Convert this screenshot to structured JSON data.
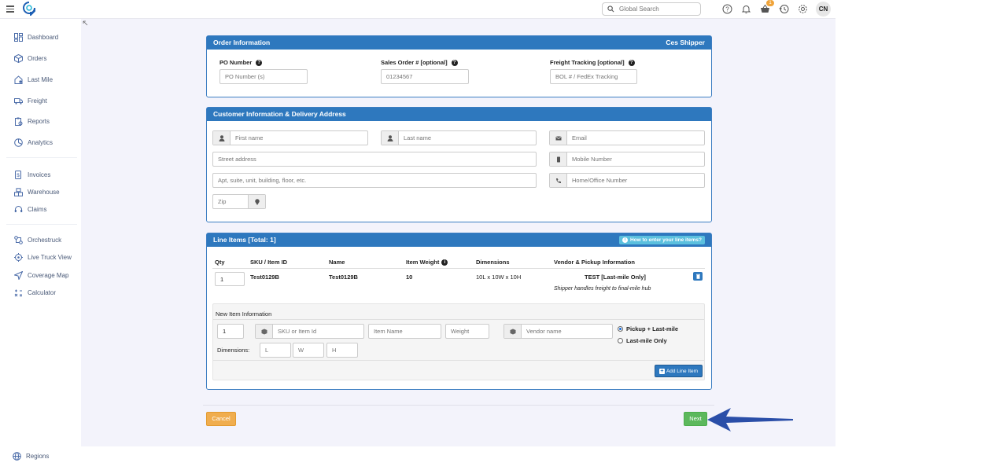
{
  "topbar": {
    "search_placeholder": "Global Search",
    "notification_count": "1",
    "avatar_initials": "CN"
  },
  "sidebar": {
    "items": [
      {
        "label": "Dashboard",
        "icon": "dashboard-icon"
      },
      {
        "label": "Orders",
        "icon": "box-icon"
      },
      {
        "label": "Last Mile",
        "icon": "house-icon"
      },
      {
        "label": "Freight",
        "icon": "truck-icon"
      },
      {
        "label": "Reports",
        "icon": "report-icon"
      },
      {
        "label": "Analytics",
        "icon": "analytics-icon"
      },
      {
        "label": "Invoices",
        "icon": "invoice-icon"
      },
      {
        "label": "Warehouse",
        "icon": "warehouse-icon"
      },
      {
        "label": "Claims",
        "icon": "headset-icon"
      },
      {
        "label": "Orchestruck",
        "icon": "orchestruck-icon"
      },
      {
        "label": "Live Truck View",
        "icon": "crosshair-icon"
      },
      {
        "label": "Coverage Map",
        "icon": "send-icon"
      },
      {
        "label": "Calculator",
        "icon": "calculator-icon"
      }
    ],
    "footer_item": {
      "label": "Regions",
      "icon": "globe-icon"
    }
  },
  "order_info": {
    "title": "Order Information",
    "shipper": "Ces Shipper",
    "po_label": "PO Number",
    "po_placeholder": "PO Number (s)",
    "so_label": "Sales Order # [optional]",
    "so_placeholder": "01234567",
    "freight_label": "Freight Tracking [optional]",
    "freight_placeholder": "BOL # / FedEx Tracking"
  },
  "customer": {
    "title": "Customer Information & Delivery Address",
    "first_name": "First name",
    "last_name": "Last name",
    "email": "Email",
    "street": "Street address",
    "mobile": "Mobile Number",
    "apt": "Apt, suite, unit, building, floor, etc.",
    "home": "Home/Office Number",
    "zip": "Zip"
  },
  "line_items": {
    "title": "Line Items [Total: 1]",
    "help_button": "How to enter your line items?",
    "headers": {
      "qty": "Qty",
      "sku": "SKU / Item ID",
      "name": "Name",
      "weight": "Item Weight",
      "dimensions": "Dimensions",
      "vendor": "Vendor & Pickup Information"
    },
    "row": {
      "qty": "1",
      "sku": "Test0129B",
      "name": "Test0129B",
      "weight": "10",
      "dimensions": "10L x 10W x 10H",
      "vendor": "TEST [Last-mile Only]",
      "note": "Shipper handles freight to final-mile hub"
    },
    "new_item": {
      "title": "New Item Information",
      "qty_value": "1",
      "sku_placeholder": "SKU or Item Id",
      "name_placeholder": "Item Name",
      "weight_placeholder": "Weight",
      "vendor_placeholder": "Vendor name",
      "dimensions_label": "Dimensions:",
      "l_placeholder": "L",
      "w_placeholder": "W",
      "h_placeholder": "H",
      "radio_pickup": "Pickup + Last-mile",
      "radio_lastmile": "Last-mile Only",
      "add_button": "Add Line Item"
    }
  },
  "footer": {
    "cancel": "Cancel",
    "next": "Next"
  },
  "colors": {
    "panel_header": "#2e78be",
    "cancel": "#f0ad4e",
    "next": "#5cb85c",
    "arrow": "#2a4ea8",
    "content_bg": "#f3f3fb"
  }
}
